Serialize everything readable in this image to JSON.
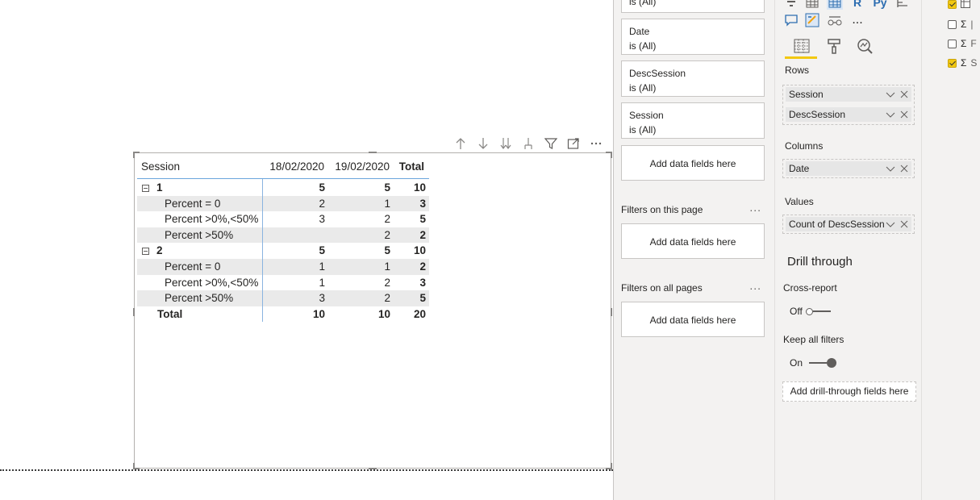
{
  "matrix": {
    "headers": [
      "Session",
      "18/02/2020",
      "19/02/2020",
      "Total"
    ],
    "rows": [
      {
        "label": "1",
        "v1": "5",
        "v2": "5",
        "total": "10",
        "kind": "group"
      },
      {
        "label": "Percent = 0",
        "v1": "2",
        "v2": "1",
        "total": "3",
        "kind": "child"
      },
      {
        "label": "Percent >0%,<50%",
        "v1": "3",
        "v2": "2",
        "total": "5",
        "kind": "child"
      },
      {
        "label": "Percent >50%",
        "v1": "",
        "v2": "2",
        "total": "2",
        "kind": "child"
      },
      {
        "label": "2",
        "v1": "5",
        "v2": "5",
        "total": "10",
        "kind": "group"
      },
      {
        "label": "Percent = 0",
        "v1": "1",
        "v2": "1",
        "total": "2",
        "kind": "child"
      },
      {
        "label": "Percent >0%,<50%",
        "v1": "1",
        "v2": "2",
        "total": "3",
        "kind": "child"
      },
      {
        "label": "Percent >50%",
        "v1": "3",
        "v2": "2",
        "total": "5",
        "kind": "child"
      },
      {
        "label": "Total",
        "v1": "10",
        "v2": "10",
        "total": "20",
        "kind": "total"
      }
    ]
  },
  "visual_header_icons": [
    "arrow-up-icon",
    "arrow-down-icon",
    "double-arrow-down-icon",
    "expand-hierarchy-icon",
    "filter-icon",
    "focus-mode-icon",
    "more-options-icon"
  ],
  "filters": {
    "top_partial_value": "is (All)",
    "cards": [
      {
        "name": "Date",
        "value": "is (All)"
      },
      {
        "name": "DescSession",
        "value": "is (All)"
      },
      {
        "name": "Session",
        "value": "is (All)"
      }
    ],
    "add_fields_label": "Add data fields here",
    "page_section": "Filters on this page",
    "all_pages_section": "Filters on all pages",
    "section_more": "..."
  },
  "visualizations": {
    "more_visuals": "...",
    "rows_label": "Rows",
    "rows_fields": [
      "Session",
      "DescSession"
    ],
    "columns_label": "Columns",
    "columns_fields": [
      "Date"
    ],
    "values_label": "Values",
    "values_fields": [
      "Count of DescSession"
    ],
    "drill_title": "Drill through",
    "cross_report_label": "Cross-report",
    "cross_report_state": "Off",
    "keep_filters_label": "Keep all filters",
    "keep_filters_state": "On",
    "drill_add_label": "Add drill-through fields here"
  },
  "fields": {
    "items": [
      {
        "checked": true,
        "icon": "table-icon"
      },
      {
        "checked": false,
        "icon": "sigma"
      },
      {
        "checked": false,
        "icon": "sigma"
      },
      {
        "checked": true,
        "icon": "sigma"
      }
    ],
    "sigma": "Σ"
  },
  "colors": {
    "accent": "#f2c811",
    "header_line": "#6aa5dd",
    "row_shade": "#eaeaea",
    "pane_bg": "#f3f2f1"
  }
}
